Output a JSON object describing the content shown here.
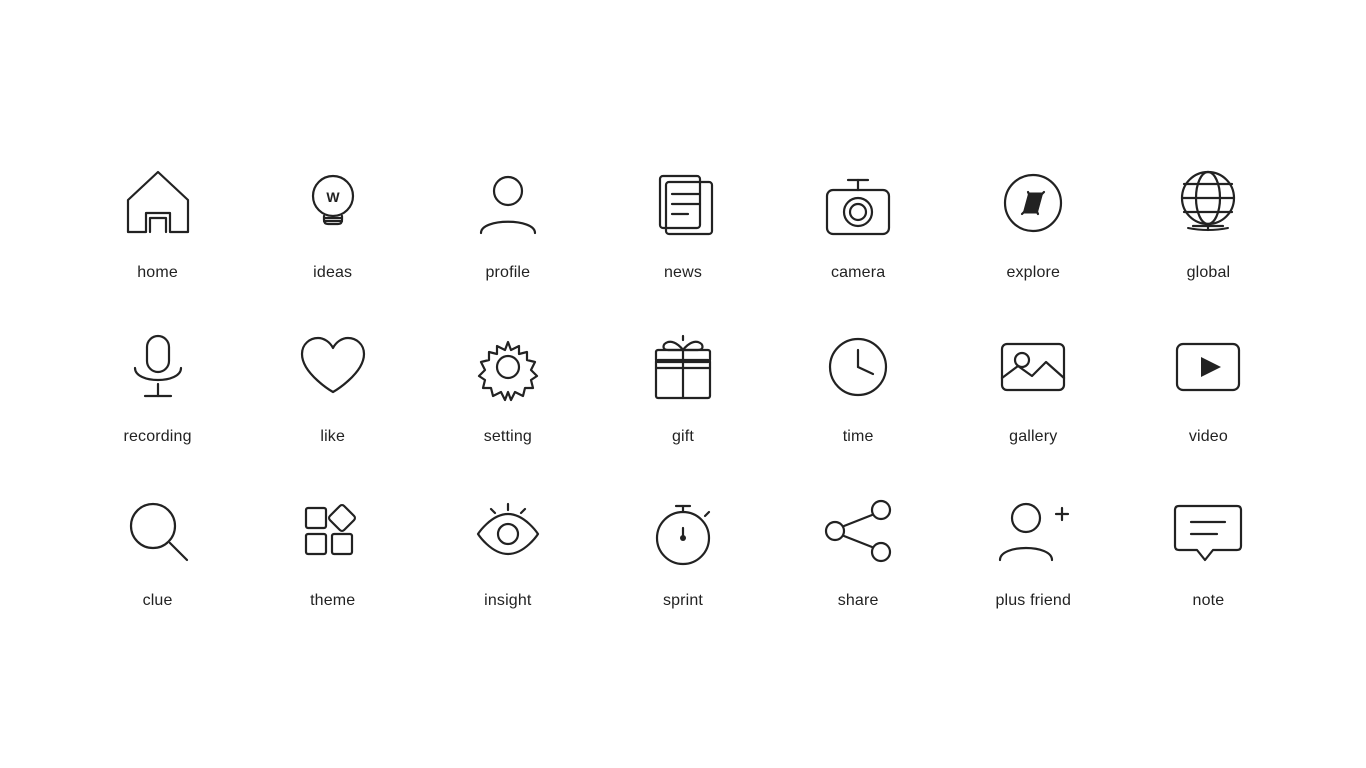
{
  "icons": [
    {
      "id": "home",
      "label": "home"
    },
    {
      "id": "ideas",
      "label": "ideas"
    },
    {
      "id": "profile",
      "label": "profile"
    },
    {
      "id": "news",
      "label": "news"
    },
    {
      "id": "camera",
      "label": "camera"
    },
    {
      "id": "explore",
      "label": "explore"
    },
    {
      "id": "global",
      "label": "global"
    },
    {
      "id": "recording",
      "label": "recording"
    },
    {
      "id": "like",
      "label": "like"
    },
    {
      "id": "setting",
      "label": "setting"
    },
    {
      "id": "gift",
      "label": "gift"
    },
    {
      "id": "time",
      "label": "time"
    },
    {
      "id": "gallery",
      "label": "gallery"
    },
    {
      "id": "video",
      "label": "video"
    },
    {
      "id": "clue",
      "label": "clue"
    },
    {
      "id": "theme",
      "label": "theme"
    },
    {
      "id": "insight",
      "label": "insight"
    },
    {
      "id": "sprint",
      "label": "sprint"
    },
    {
      "id": "share",
      "label": "share"
    },
    {
      "id": "plus-friend",
      "label": "plus friend"
    },
    {
      "id": "note",
      "label": "note"
    }
  ]
}
